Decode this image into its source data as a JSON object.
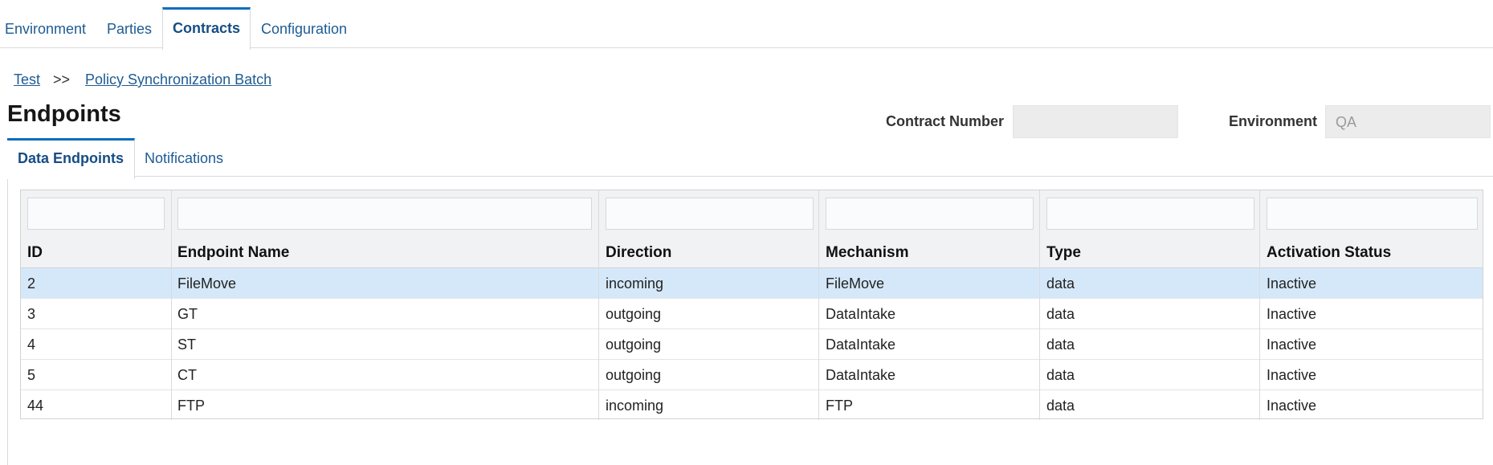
{
  "topnav": {
    "tabs": [
      {
        "label": "Environment",
        "active": false
      },
      {
        "label": "Parties",
        "active": false
      },
      {
        "label": "Contracts",
        "active": true
      },
      {
        "label": "Configuration",
        "active": false
      }
    ]
  },
  "breadcrumb": {
    "items": [
      "Test",
      "Policy Synchronization Batch"
    ],
    "separator": ">>"
  },
  "page": {
    "title": "Endpoints"
  },
  "fields": {
    "contract_number": {
      "label": "Contract Number",
      "value": ""
    },
    "environment": {
      "label": "Environment",
      "value": "QA"
    }
  },
  "subtabs": [
    {
      "label": "Data Endpoints",
      "active": true
    },
    {
      "label": "Notifications",
      "active": false
    }
  ],
  "table": {
    "columns": [
      "ID",
      "Endpoint Name",
      "Direction",
      "Mechanism",
      "Type",
      "Activation Status"
    ],
    "rows": [
      [
        "2",
        "FileMove",
        "incoming",
        "FileMove",
        "data",
        "Inactive"
      ],
      [
        "3",
        "GT",
        "outgoing",
        "DataIntake",
        "data",
        "Inactive"
      ],
      [
        "4",
        "ST",
        "outgoing",
        "DataIntake",
        "data",
        "Inactive"
      ],
      [
        "5",
        "CT",
        "outgoing",
        "DataIntake",
        "data",
        "Inactive"
      ],
      [
        "44",
        "FTP",
        "incoming",
        "FTP",
        "data",
        "Inactive"
      ]
    ],
    "selected_row": 0
  },
  "colors": {
    "accent": "#0b6dbd",
    "link": "#1d5b94",
    "selected_row": "#d5e8fa"
  }
}
